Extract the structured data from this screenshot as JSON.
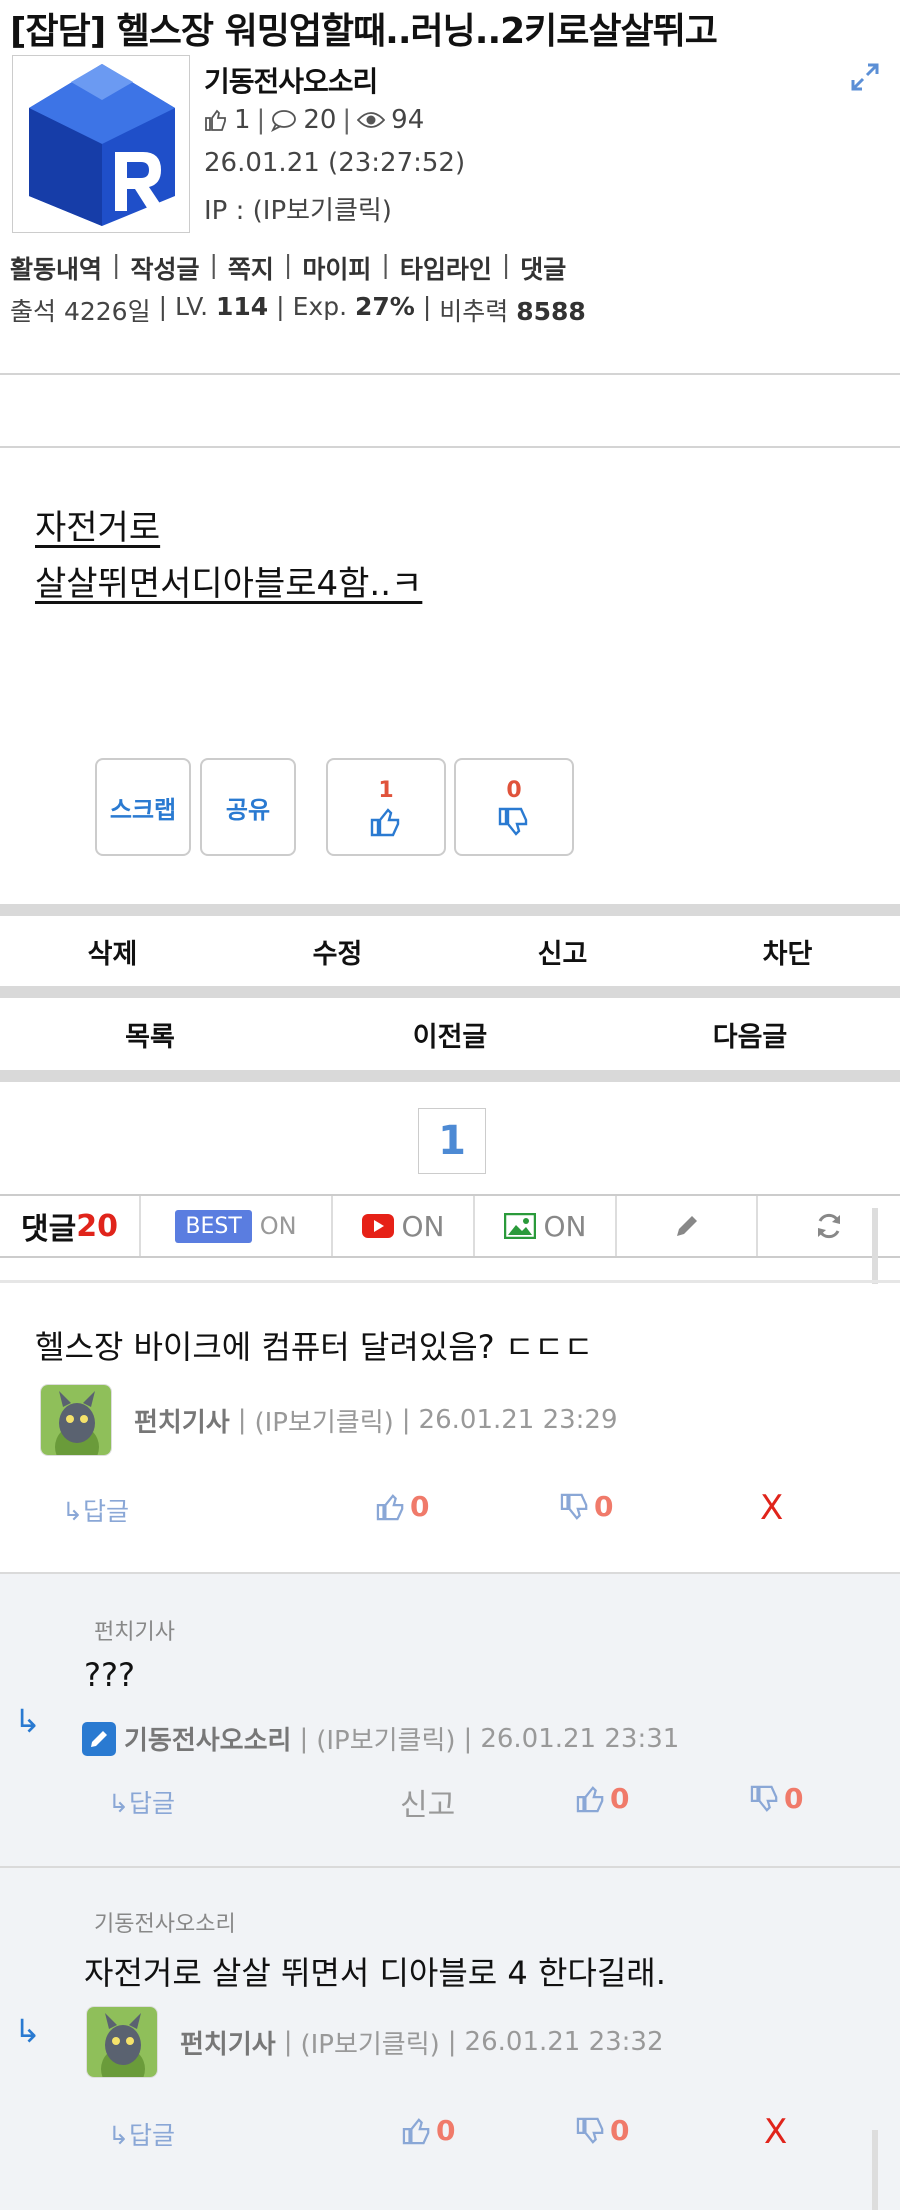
{
  "post": {
    "title": "[잡담] 헬스장 워밍업할때..러닝..2키로살살뛰고",
    "author": "기동전사오소리",
    "likes": "1",
    "comments": "20",
    "views": "94",
    "datetime": "26.01.21 (23:27:52)",
    "ip": "IP : (IP보기클릭)",
    "body_lines": [
      "자전거로",
      "살살뛰면서디아블로4함..ㅋ"
    ]
  },
  "user_links": [
    "활동내역",
    "작성글",
    "쪽지",
    "마이피",
    "타임라인",
    "댓글"
  ],
  "member_info": {
    "attendance": "출석 4226일",
    "lv_label": "LV.",
    "lv_value": "114",
    "exp_label": "Exp.",
    "exp_value": "27%",
    "power_label": "비추력",
    "power_value": "8588"
  },
  "buttons": {
    "scrap": "스크랩",
    "share": "공유",
    "upvote_count": "1",
    "downvote_count": "0"
  },
  "actions": [
    "삭제",
    "수정",
    "신고",
    "차단"
  ],
  "nav": [
    "목록",
    "이전글",
    "다음글"
  ],
  "pagination": {
    "current": "1"
  },
  "comment_toolbar": {
    "label": "댓글",
    "count": "20",
    "best": "BEST",
    "best_state": "ON",
    "video_state": "ON",
    "image_state": "ON"
  },
  "comments": [
    {
      "text": "헬스장 바이크에 컴퓨터 달려있음? ㄷㄷㄷ",
      "nick": "펀치기사",
      "ip": "(IP보기클릭)",
      "date": "26.01.21 23:29",
      "reply": "↳답글",
      "likes": "0",
      "dislikes": "0",
      "delete": "X"
    },
    {
      "reply_to": "펀치기사",
      "text": "???",
      "nick": "기동전사오소리",
      "ip": "(IP보기클릭)",
      "date": "26.01.21 23:31",
      "reply": "↳답글",
      "report": "신고",
      "likes": "0",
      "dislikes": "0"
    },
    {
      "reply_to": "기동전사오소리",
      "text": "자전거로 살살 뛰면서 디아블로 4 한다길래.",
      "nick": "펀치기사",
      "ip": "(IP보기클릭)",
      "date": "26.01.21 23:32",
      "reply": "↳답글",
      "likes": "0",
      "dislikes": "0",
      "delete": "X"
    }
  ],
  "colors": {
    "accent_blue": "#2a7ad1",
    "vote_red": "#e0533b",
    "count_red": "#e0241b",
    "best_badge": "#5a7de0",
    "page_num": "#4d8ad4"
  }
}
